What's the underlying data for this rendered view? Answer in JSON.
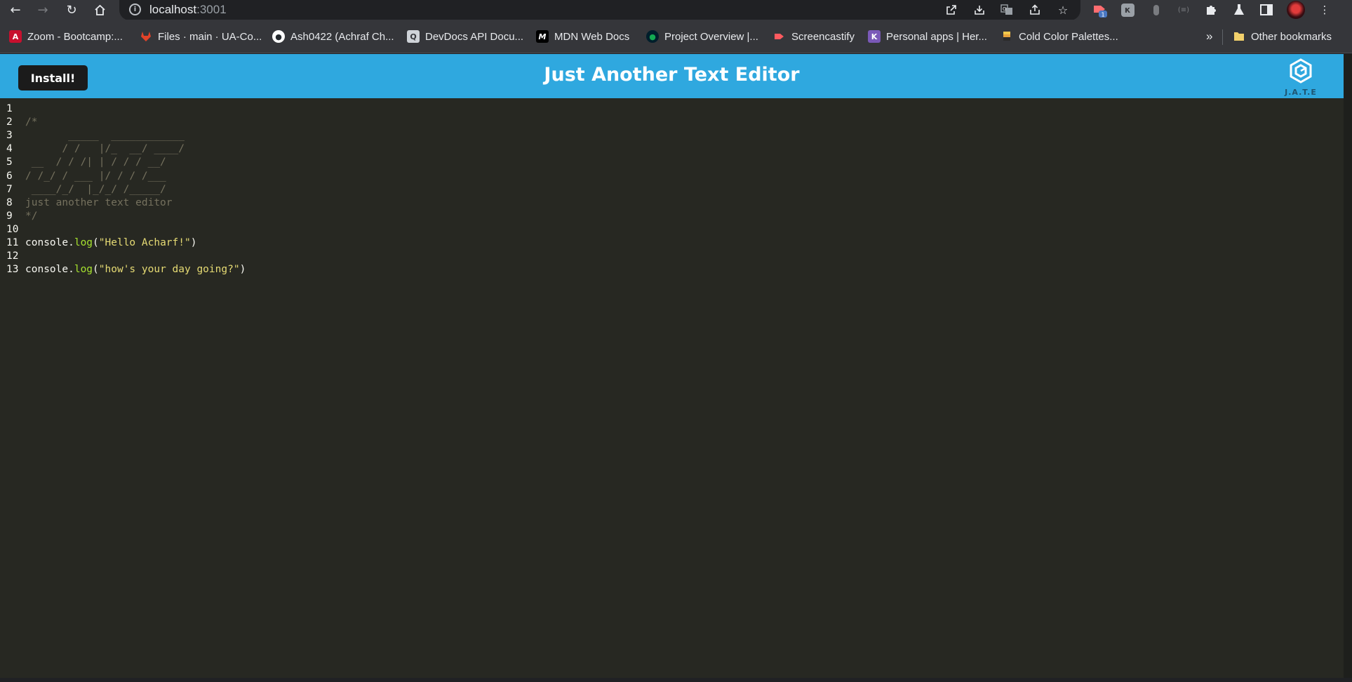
{
  "browser": {
    "url_host": "localhost",
    "url_port": ":3001",
    "profile_badge": "1"
  },
  "bookmarks": {
    "items": [
      {
        "label": "Zoom - Bootcamp:...",
        "icon": "A",
        "color": "#c8102e"
      },
      {
        "label": "Files · main · UA-Co...",
        "icon": "gitlab-icon",
        "color": "#e24329"
      },
      {
        "label": "Ash0422 (Achraf Ch...",
        "icon": "github-icon",
        "color": "#ffffff"
      },
      {
        "label": "DevDocs API Docu...",
        "icon": "devdocs-icon",
        "color": "#cfd3d8"
      },
      {
        "label": "MDN Web Docs",
        "icon": "M",
        "color": "#000000"
      },
      {
        "label": "Project Overview |...",
        "icon": "mongodb-leaf-icon",
        "color": "#13aa52"
      },
      {
        "label": "Screencastify",
        "icon": "screencastify-icon",
        "color": "#ff5a5f"
      },
      {
        "label": "Personal apps | Her...",
        "icon": "K",
        "color": "#7a59b8"
      },
      {
        "label": "Cold Color Palettes...",
        "icon": "palette-icon",
        "color": "#f2c94c"
      }
    ],
    "overflow": "»",
    "other_label": "Other bookmarks"
  },
  "app": {
    "install_label": "Install!",
    "title": "Just Another Text Editor",
    "logo_text": "J.A.T.E",
    "header_color": "#2fa8df"
  },
  "editor": {
    "background": "#272822",
    "lines": [
      {
        "n": "1",
        "tokens": []
      },
      {
        "n": "2",
        "tokens": [
          {
            "t": "comment",
            "v": "/*"
          }
        ]
      },
      {
        "n": "3",
        "tokens": [
          {
            "t": "comment",
            "v": "       _____  ____________"
          }
        ]
      },
      {
        "n": "4",
        "tokens": [
          {
            "t": "comment",
            "v": "      / /   |/_  __/ ____/"
          }
        ]
      },
      {
        "n": "5",
        "tokens": [
          {
            "t": "comment",
            "v": " __  / / /| | / / / __/"
          }
        ]
      },
      {
        "n": "6",
        "tokens": [
          {
            "t": "comment",
            "v": "/ /_/ / ___ |/ / / /___"
          }
        ]
      },
      {
        "n": "7",
        "tokens": [
          {
            "t": "comment",
            "v": " ____/_/  |_/_/ /_____/"
          }
        ]
      },
      {
        "n": "8",
        "tokens": [
          {
            "t": "comment",
            "v": "just another text editor"
          }
        ]
      },
      {
        "n": "9",
        "tokens": [
          {
            "t": "comment",
            "v": "*/"
          }
        ]
      },
      {
        "n": "10",
        "tokens": []
      },
      {
        "n": "11",
        "tokens": [
          {
            "t": "text",
            "v": "console."
          },
          {
            "t": "fn",
            "v": "log"
          },
          {
            "t": "text",
            "v": "("
          },
          {
            "t": "str",
            "v": "\"Hello Acharf!\""
          },
          {
            "t": "text",
            "v": ")"
          }
        ]
      },
      {
        "n": "12",
        "tokens": []
      },
      {
        "n": "13",
        "tokens": [
          {
            "t": "text",
            "v": "console."
          },
          {
            "t": "fn",
            "v": "log"
          },
          {
            "t": "text",
            "v": "("
          },
          {
            "t": "str",
            "v": "\"how's your day going?\""
          },
          {
            "t": "text",
            "v": ")"
          }
        ]
      }
    ]
  }
}
